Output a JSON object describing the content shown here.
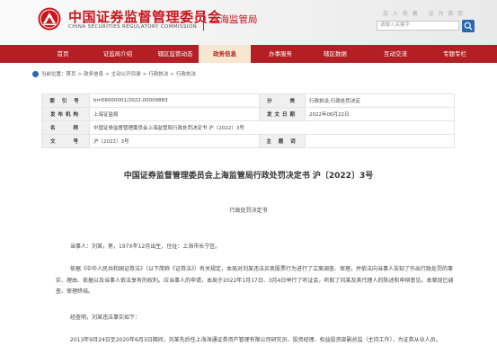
{
  "header": {
    "site_name_cn": "中国证券监督管理委员会",
    "site_name_en": "CHINA SECURITIES REGULATORY COMMISSION",
    "bureau": "上海监管局",
    "top_links": "加 入 收 藏 · 设 为 首 页",
    "search_placeholder": "请输入关键字"
  },
  "nav": {
    "items": [
      {
        "label": "首页"
      },
      {
        "label": "证监局介绍"
      },
      {
        "label": "辖区监管动态"
      },
      {
        "label": "政务信息"
      },
      {
        "label": "办事服务"
      },
      {
        "label": "辖区数据"
      },
      {
        "label": "互动交流"
      },
      {
        "label": "专题专栏"
      }
    ],
    "active_color": "#b31f24"
  },
  "breadcrumb": {
    "items": [
      "当前位置：首页",
      "政务信息",
      "主动公开目录",
      "行政执法",
      "行政执法"
    ]
  },
  "info_table": {
    "index_label": "索 引 号",
    "index_value": "bm56000001/2022-00009883",
    "category_label": "分　　类",
    "category_value": "行政执法;行政处罚决定",
    "issuer_label": "发布机构",
    "issuer_value": "上海证监局",
    "date_label": "发文日期",
    "date_value": "2022年06月22日",
    "name_label": "名　　称",
    "name_value": "中国证券监督管理委员会上海监管局行政处罚决定书 沪〔2022〕3号",
    "docno_label": "文　　号",
    "docno_value": "沪〔2022〕3号",
    "keyword_label": "主 题 词",
    "keyword_value": ""
  },
  "document": {
    "title": "中国证券监督管理委员会上海监管局行政处罚决定书 沪〔2022〕3号",
    "subtitle": "行政处罚决定书",
    "paragraphs": [
      "当事人：刘某，男，197X年12月出生，住址：上海市长宁区。",
      "依据《中华人民共和国证券法》（以下简称《证券法》）有关规定，本局对刘某违法买卖股票行为进行了立案调查、审理，并依法向当事人告知了作出行政处罚的事实、理由、依据以及当事人依法享有的权利。应当事人的申请，本局于2022年1月17日、3月4日举行了听证会，听取了刘某及其代理人的陈述和申辩意见。本案现已调查、审理终结。",
      "经查明，刘某违法事实如下：",
      "2013年9月24日至2020年6月3日期间，刘某先后任上海海通证券资产管理有限公司研究员、投资经理、权益投资部副总监（主持工作），为证券从业人员。"
    ]
  }
}
